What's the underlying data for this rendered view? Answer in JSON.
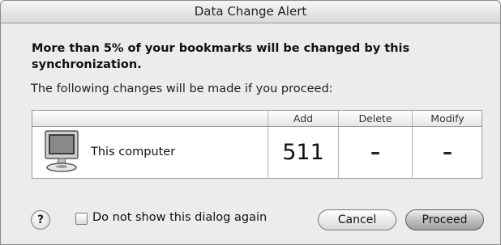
{
  "window": {
    "title": "Data Change Alert"
  },
  "message": {
    "headline": "More than 5% of your bookmarks will be changed by this synchronization.",
    "subline": "The following changes will be made if you proceed:"
  },
  "table": {
    "columns": [
      "Add",
      "Delete",
      "Modify"
    ],
    "rows": [
      {
        "label": "This computer",
        "icon": "computer-icon",
        "add": "511",
        "delete": "–",
        "modify": "–"
      }
    ]
  },
  "footer": {
    "help_label": "?",
    "checkbox_label": "Do not show this dialog again",
    "checkbox_checked": false,
    "cancel_label": "Cancel",
    "proceed_label": "Proceed"
  }
}
